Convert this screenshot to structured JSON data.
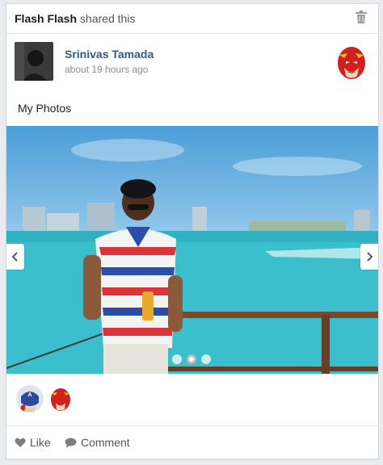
{
  "share": {
    "actor": "Flash Flash",
    "verb": "shared this",
    "delete_icon": "trash-icon"
  },
  "post": {
    "author": "Srinivas Tamada",
    "time": "about 19 hours ago",
    "text": "My Photos",
    "badge_icon": "flash-avatar-icon"
  },
  "carousel": {
    "slide_count": 3,
    "active_slide": 2,
    "prev_icon": "chevron-left-icon",
    "next_icon": "chevron-right-icon"
  },
  "likers": [
    {
      "icon": "captain-america-avatar"
    },
    {
      "icon": "flash-avatar"
    }
  ],
  "actions": {
    "like_label": "Like",
    "comment_label": "Comment"
  },
  "colors": {
    "link": "#2a5b95",
    "muted": "#8a8d91",
    "flash_red": "#d21f1f",
    "flash_yellow": "#f3c214"
  }
}
